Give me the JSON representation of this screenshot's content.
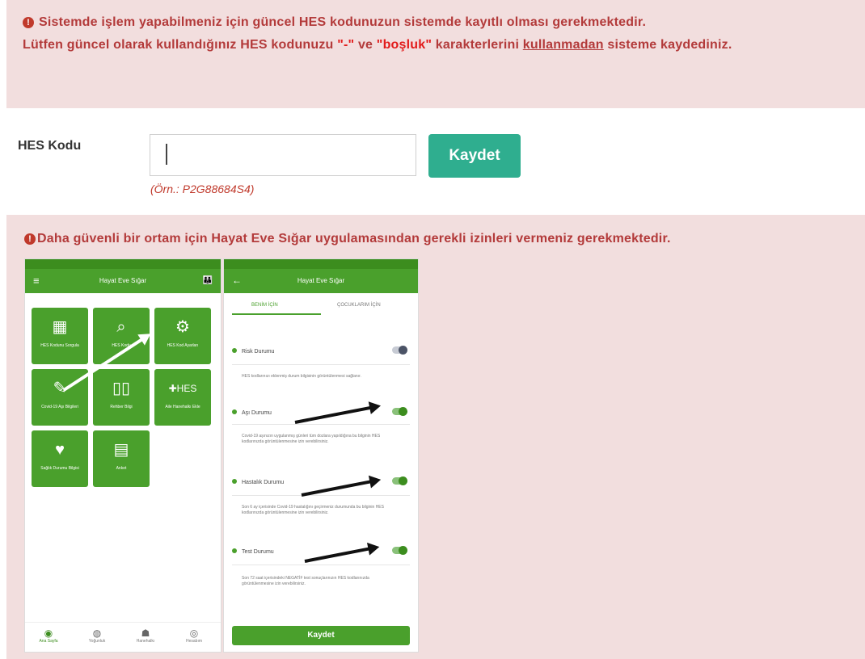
{
  "notice_top": {
    "part1": "Sistemde işlem yapabilmeniz için güncel HES kodunuzun sistemde kayıtlı olması gerekmektedir.",
    "part2": "Lütfen güncel olarak kullandığınız HES kodunuzu ",
    "dash": "\"-\"",
    "part3": " ve ",
    "space": "\"boşluk\"",
    "part4": " karakterlerini ",
    "underlined": "kullanmadan",
    "part5": " sisteme kaydediniz."
  },
  "form": {
    "label": "HES Kodu",
    "input_value": "",
    "example": "(Örn.: P2G88684S4)",
    "save_label": "Kaydet"
  },
  "notice_bottom": {
    "text": "Daha güvenli bir ortam için Hayat Eve Sığar uygulamasından gerekli izinleri vermeniz gerekmektedir."
  },
  "colors": {
    "alert_bg": "#f2dede",
    "alert_text": "#b33a3a",
    "button": "#2fae8f",
    "app_green": "#4aa02c"
  },
  "phone_left": {
    "app_title": "Hayat Eve Sığar",
    "tiles": [
      {
        "label": "HES Kodunu Sorgula",
        "icon": "qr-icon"
      },
      {
        "label": "HES Kodu",
        "icon": "search-icon"
      },
      {
        "label": "HES Kod Ayarları",
        "icon": "gear-icon"
      },
      {
        "label": "Covid-19 Aşı Bilgileri",
        "icon": "syringe-icon"
      },
      {
        "label": "Rehber Bilgi",
        "icon": "book-icon"
      },
      {
        "label": "Aile Hanehalkı Ekle",
        "icon": "people-icon"
      },
      {
        "label": "Sağlık Durumu Bilgisi",
        "icon": "heart-icon"
      },
      {
        "label": "Anket",
        "icon": "clipboard-icon"
      }
    ],
    "nav": [
      "Ana Sayfa",
      "Yoğunluk",
      "Hanehalkı",
      "Hesabım"
    ]
  },
  "phone_right": {
    "app_title": "Hayat Eve Sığar",
    "tabs": [
      "BENİM İÇİN",
      "ÇOCUKLARIM İÇİN"
    ],
    "rows": [
      {
        "label": "Risk Durumu",
        "on": false,
        "desc": "HES kodlarınızı eklenmiş durum bilgisinin görüntülenmesi sağlanır."
      },
      {
        "label": "Aşı Durumu",
        "on": true,
        "desc": "Covid-19 aşınızın uygulanmış günleri tüm dozlara yapıldığına bu bilginin HES kodlarınızda görüntülenmesine izin verebilirsiniz."
      },
      {
        "label": "Hastalık Durumu",
        "on": true,
        "desc": "Son 6 ay içerisinde Covid-19 hastalığını geçirmeniz durumunda bu bilginin HES kodlarınızda görüntülenmesine izin verebilirsiniz."
      },
      {
        "label": "Test Durumu",
        "on": true,
        "desc": "Son 72 saat içerisindeki NEGATİF test sonuçlarınızın HES kodlarınızda görüntülenmesine izin verebilirsiniz."
      }
    ],
    "save_label": "Kaydet"
  }
}
